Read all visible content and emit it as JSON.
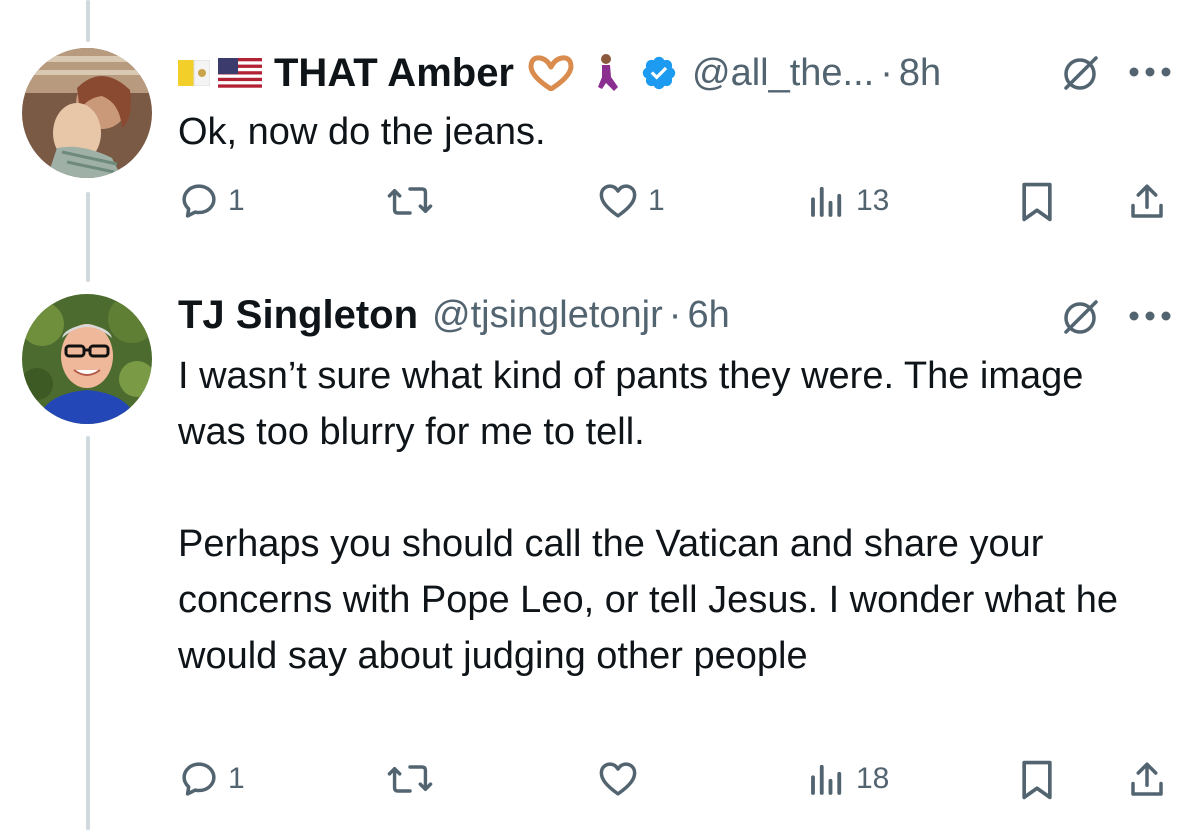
{
  "tweets": [
    {
      "display_name": "THAT Amber",
      "handle": "@all_the...",
      "dot": "·",
      "time": "8h",
      "text": "Ok, now do the jeans.",
      "reply_count": "1",
      "retweet_count": "",
      "like_count": "1",
      "view_count": "13",
      "icons": [
        "vatican-flag-icon",
        "us-flag-icon",
        "heart-hands-icon",
        "kneeling-person-icon",
        "verified-badge-icon"
      ]
    },
    {
      "display_name": "TJ Singleton",
      "handle": "@tjsingletonjr",
      "dot": "·",
      "time": "6h",
      "text_paragraph_1": "I wasn’t sure what kind of pants they were. The image was too blurry for me to tell.",
      "text_paragraph_2": "Perhaps you should call the Vatican and share your concerns with Pope Leo, or tell Jesus. I wonder what he would say about judging other people",
      "reply_count": "1",
      "retweet_count": "",
      "like_count": "",
      "view_count": "18"
    }
  ],
  "colors": {
    "text_primary": "#0f1419",
    "text_secondary": "#536471",
    "thread_line": "#cfd9de",
    "verified_blue": "#1d9bf0"
  }
}
